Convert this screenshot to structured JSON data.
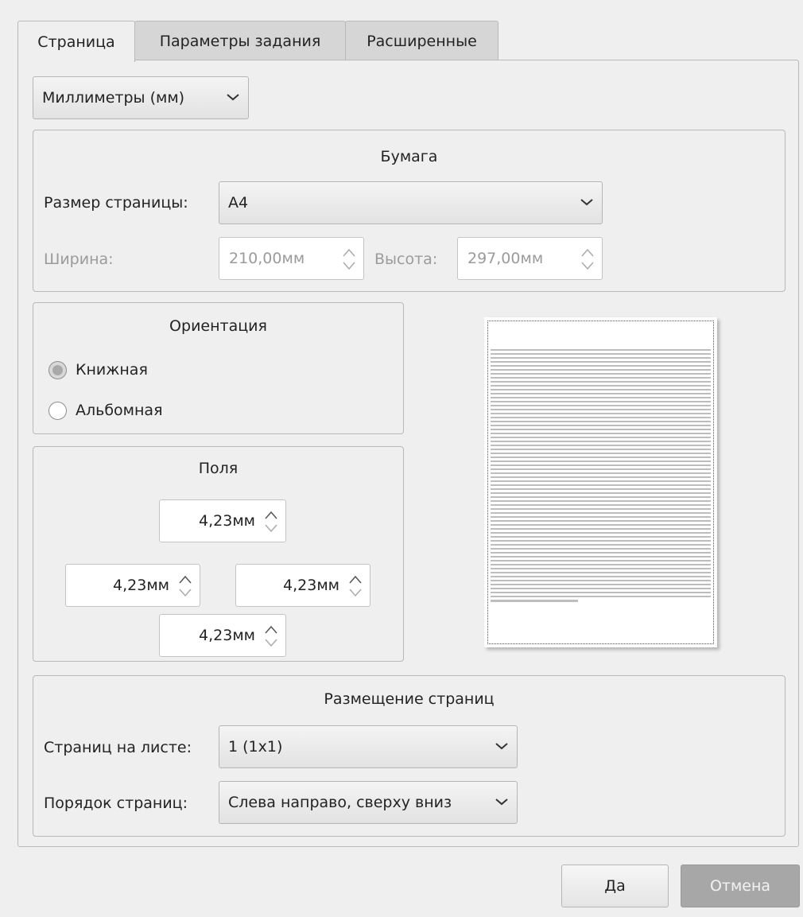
{
  "tabs": [
    {
      "label": "Страница",
      "active": true
    },
    {
      "label": "Параметры задания",
      "active": false
    },
    {
      "label": "Расширенные",
      "active": false
    }
  ],
  "units": {
    "selected": "Миллиметры (мм)"
  },
  "paper": {
    "title": "Бумага",
    "page_size_label": "Размер страницы:",
    "page_size_value": "A4",
    "width_label": "Ширина:",
    "width_value": "210,00мм",
    "height_label": "Высота:",
    "height_value": "297,00мм"
  },
  "orientation": {
    "title": "Ориентация",
    "options": [
      {
        "label": "Книжная",
        "checked": true
      },
      {
        "label": "Альбомная",
        "checked": false
      }
    ]
  },
  "margins": {
    "title": "Поля",
    "top": "4,23мм",
    "left": "4,23мм",
    "right": "4,23мм",
    "bottom": "4,23мм"
  },
  "layout": {
    "title": "Размещение страниц",
    "pages_per_sheet_label": "Страниц на листе:",
    "pages_per_sheet_value": "1 (1x1)",
    "page_order_label": "Порядок страниц:",
    "page_order_value": "Слева направо, сверху вниз"
  },
  "buttons": {
    "ok": "Да",
    "cancel": "Отмена"
  },
  "icons": {
    "dropdown": "chevron-down-icon",
    "spin": "spin-arrows-icon"
  }
}
